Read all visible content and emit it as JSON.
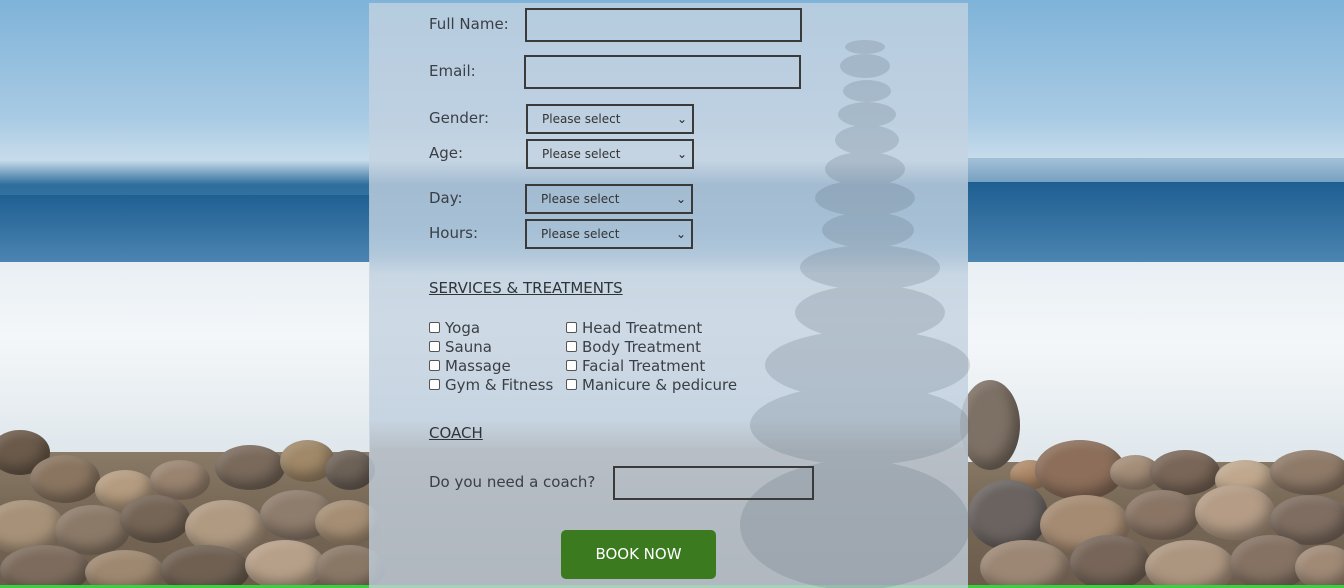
{
  "form": {
    "full_name_label": "Full Name:",
    "full_name_value": "",
    "email_label": "Email:",
    "email_value": "",
    "gender_label": "Gender:",
    "gender_selected": "Please select",
    "age_label": "Age:",
    "age_selected": "Please select",
    "day_label": "Day:",
    "day_selected": "Please select",
    "hours_label": "Hours:",
    "hours_selected": "Please select"
  },
  "services": {
    "heading": "SERVICES & TREATMENTS",
    "left": [
      "Yoga",
      "Sauna",
      "Massage",
      "Gym & Fitness"
    ],
    "right": [
      "Head Treatment",
      "Body Treatment",
      "Facial Treatment",
      "Manicure & pedicure"
    ]
  },
  "coach": {
    "heading": "COACH",
    "question": "Do you need a coach?",
    "value": ""
  },
  "submit": {
    "label": "BOOK NOW"
  },
  "colors": {
    "button": "#3c7a1f",
    "panel": "#c4d2e0",
    "accent_line": "#3ecf3e"
  },
  "icons": {
    "select_arrow": "chevron-down-icon"
  }
}
